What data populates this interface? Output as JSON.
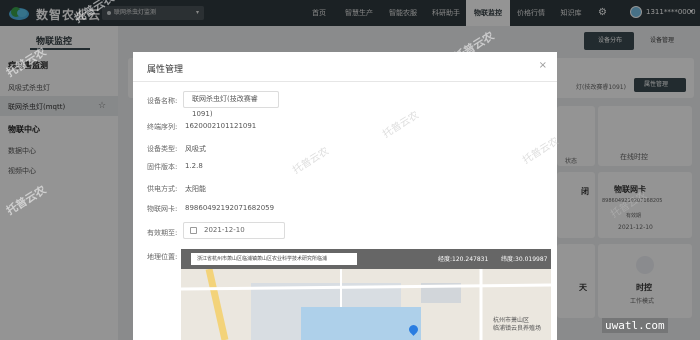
{
  "app": {
    "brand": "数智农业云",
    "device_select": "联网杀虫灯监测"
  },
  "nav": [
    "首页",
    "智慧生产",
    "智能农服",
    "科研助手",
    "物联监控",
    "价格行情",
    "知识库"
  ],
  "user": {
    "phone": "1311****0000"
  },
  "sidebar": {
    "title": "物联监控",
    "section1": "病虫害监测",
    "item1": "风吸式杀虫灯",
    "item2": "联网杀虫灯(mqtt)",
    "section2": "物联中心",
    "item3": "数据中心",
    "item4": "视频中心"
  },
  "background": {
    "btn_distribution": "设备分布",
    "btn_manage": "设备管理",
    "btn_attr": "属性管理",
    "card_status": "状态",
    "card_online": "在线时控",
    "card_close": "闭",
    "card_simcard_title": "物联网卡",
    "card_simcard_no": "8986049219207168205",
    "card_valid_label": "有效期",
    "card_valid_date": "2021-12-10",
    "card_sky": "天",
    "card_timer_title": "时控",
    "card_timer_sub": "工作模式",
    "device_label_fragment": "灯(技改赛睿1091)"
  },
  "modal": {
    "title": "属性管理",
    "close": "×",
    "fields": {
      "name_label": "设备名称:",
      "name_value": "联网杀虫灯(技改赛睿1091)",
      "serial_label": "终端序列:",
      "serial_value": "1620002101121091",
      "type_label": "设备类型:",
      "type_value": "风吸式",
      "firmware_label": "固件版本:",
      "firmware_value": "1.2.8",
      "power_label": "供电方式:",
      "power_value": "太阳能",
      "sim_label": "物联网卡:",
      "sim_value": "89860492192071682059",
      "valid_label": "有效期至:",
      "valid_value": "2021-12-10",
      "location_label": "地理位置:"
    },
    "map": {
      "address": "浙江省杭州市萧山区临浦镇萧山区农业科学技术研究所临浦",
      "lng": "经度:120.247831",
      "lat": "纬度:30.019987",
      "label_area": "杭州市萧山区",
      "label_area2": "临浦镇云良养殖场"
    }
  },
  "watermarks": [
    "托普云农",
    "托普云农",
    "托普云农",
    "托普云农",
    "托普云农",
    "托普云农",
    "托普云农",
    "托普云农"
  ],
  "corner_watermark": "uwatl.com"
}
